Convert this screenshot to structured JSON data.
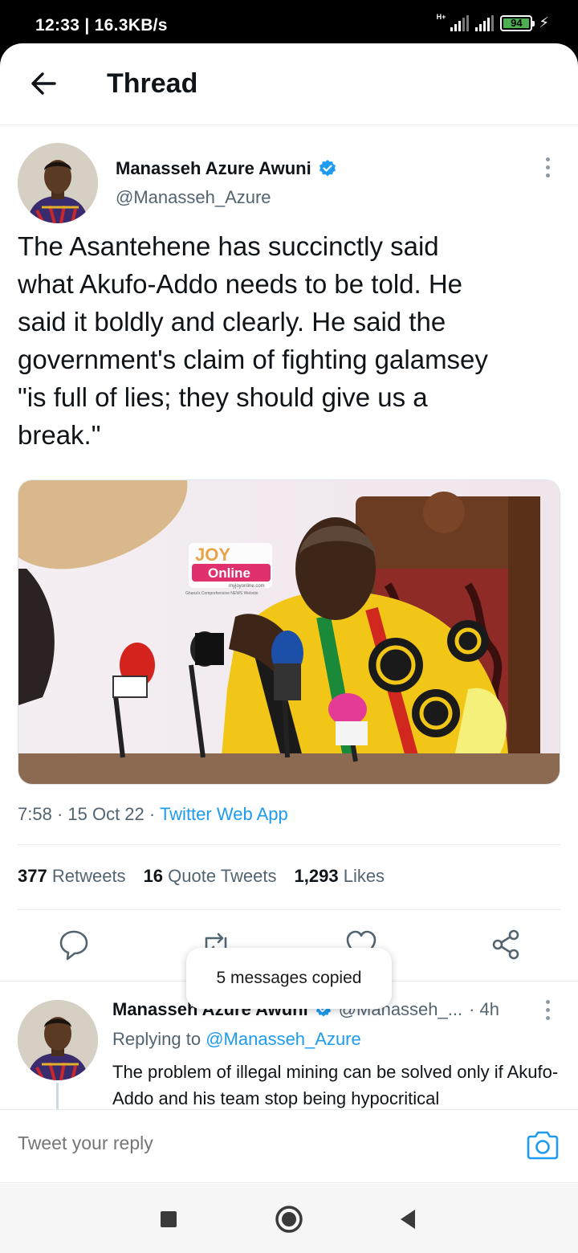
{
  "status_bar": {
    "time": "12:33",
    "separator": " | ",
    "net_speed": "16.3KB/s",
    "network": "H+",
    "battery": "94",
    "icons": [
      "signal-icon",
      "battery-icon",
      "charging-icon"
    ]
  },
  "header": {
    "title": "Thread",
    "back_icon": "back-arrow-icon"
  },
  "tweet": {
    "author_name": "Manasseh Azure Awuni",
    "author_handle": "@Manasseh_Azure",
    "verified": true,
    "text": "The Asantehene has succinctly said\nwhat Akufo-Addo needs to be told. He\nsaid it boldly and clearly. He said the\ngovernment's claim of fighting galamsey\n\"is full of lies; they should give us a\nbreak.\"",
    "media": {
      "logo_word1": "JOY",
      "logo_word2": "Online",
      "logo_url": "myjoyonline.com",
      "logo_tagline": "Ghana's Comprehensive NEWS Website"
    },
    "time": "7:58",
    "date": "15 Oct 22",
    "source": "Twitter Web App",
    "retweets_count": "377",
    "retweets_label": "Retweets",
    "quotes_count": "16",
    "quotes_label": "Quote Tweets",
    "likes_count": "1,293",
    "likes_label": "Likes"
  },
  "toast": {
    "text": "5 messages copied"
  },
  "reply": {
    "author_name": "Manasseh Azure Awuni",
    "author_handle": "@Manasseh_...",
    "age": "· 4h",
    "replying_prefix": "Replying to",
    "replying_to": "@Manasseh_Azure",
    "text": "The problem of illegal mining can be solved only if Akufo-Addo and his team stop being hypocritical"
  },
  "composer": {
    "placeholder": "Tweet your reply"
  },
  "colors": {
    "accent": "#1d9bf0",
    "secondary_text": "#536471",
    "primary_text": "#0f1419"
  }
}
